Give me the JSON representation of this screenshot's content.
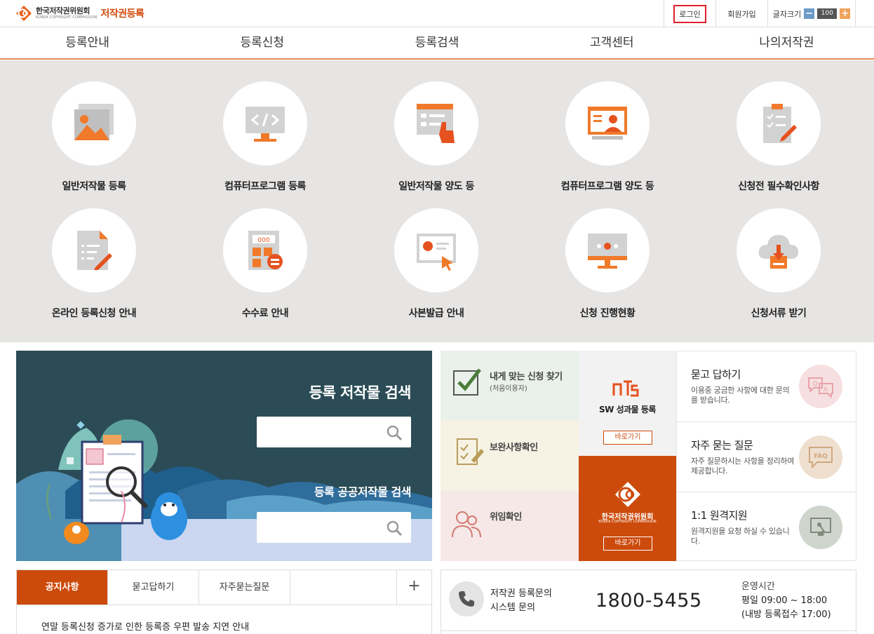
{
  "header": {
    "org_name": "한국저작권위원회",
    "org_eng": "KOREA COPYRIGHT COMMISSION",
    "service_name": "저작권등록",
    "login": "로그인",
    "join": "회원가입",
    "font_size_label": "글자크기",
    "font_minus": "−",
    "font_value": "100",
    "font_plus": "+"
  },
  "nav": [
    "등록안내",
    "등록신청",
    "등록검색",
    "고객센터",
    "나의저작권"
  ],
  "quick_menu": [
    {
      "label": "일반저작물 등록",
      "icon": "image-gallery-icon"
    },
    {
      "label": "컴퓨터프로그램 등록",
      "icon": "code-monitor-icon"
    },
    {
      "label": "일반저작물 양도 등",
      "icon": "hand-form-icon"
    },
    {
      "label": "컴퓨터프로그램 양도 등",
      "icon": "user-monitor-icon"
    },
    {
      "label": "신청전 필수확인사항",
      "icon": "clipboard-check-icon"
    },
    {
      "label": "온라인 등록신청 안내",
      "icon": "document-pen-icon"
    },
    {
      "label": "수수료 안내",
      "icon": "calculator-icon"
    },
    {
      "label": "사본발급 안내",
      "icon": "certificate-icon"
    },
    {
      "label": "신청 진행현황",
      "icon": "progress-monitor-icon"
    },
    {
      "label": "신청서류 받기",
      "icon": "cloud-download-icon"
    }
  ],
  "search": {
    "title": "등록 저작물 검색",
    "public_title": "등록 공공저작물 검색",
    "value": "",
    "public_value": ""
  },
  "shortcuts": {
    "find": {
      "title": "내게 맞는 신청 찾기",
      "sub": "(처음이용자)"
    },
    "supplement": {
      "title": "보완사항확인"
    },
    "proxy": {
      "title": "위임확인"
    },
    "sw": {
      "title": "SW 성과물 등록",
      "button": "바로가기"
    },
    "kcc": {
      "name": "한국저작권위원회",
      "eng": "KOREA COPYRIGHT COMMISSION",
      "button": "바로가기"
    }
  },
  "support": [
    {
      "title": "묻고 답하기",
      "desc": "이용중 궁금한 사항에 대한 문의를 받습니다.",
      "icon_text": "Q A",
      "color": "#f6dfe0"
    },
    {
      "title": "자주 묻는 질문",
      "desc": "자주 질문하시는 사항을 정리하여 제공합니다.",
      "icon_text": "FAQ",
      "color": "#efdfcf"
    },
    {
      "title": "1:1 원격지원",
      "desc": "원격지원을 요청 하실 수 있습니다.",
      "icon_text": "",
      "color": "#cfd5cc"
    }
  ],
  "notice": {
    "tabs": [
      "공지사항",
      "묻고답하기",
      "자주묻는질문"
    ],
    "more": "+",
    "items": [
      "연말 등록신청 증가로 인한 등록증 우편 발송 지연 안내"
    ]
  },
  "contact": {
    "label_line1": "저작권 등록문의",
    "label_line2": "시스템 문의",
    "phone": "1800-5455",
    "hours_title": "운영시간",
    "hours_weekday": "평일 09:00 ~ 18:00",
    "hours_note": "(내방 등록접수 17:00)"
  },
  "colors": {
    "brand": "#cc4b0c",
    "accent": "#f07a2a",
    "panel": "#2b4c56",
    "quick_bg": "#e7e5e4"
  }
}
